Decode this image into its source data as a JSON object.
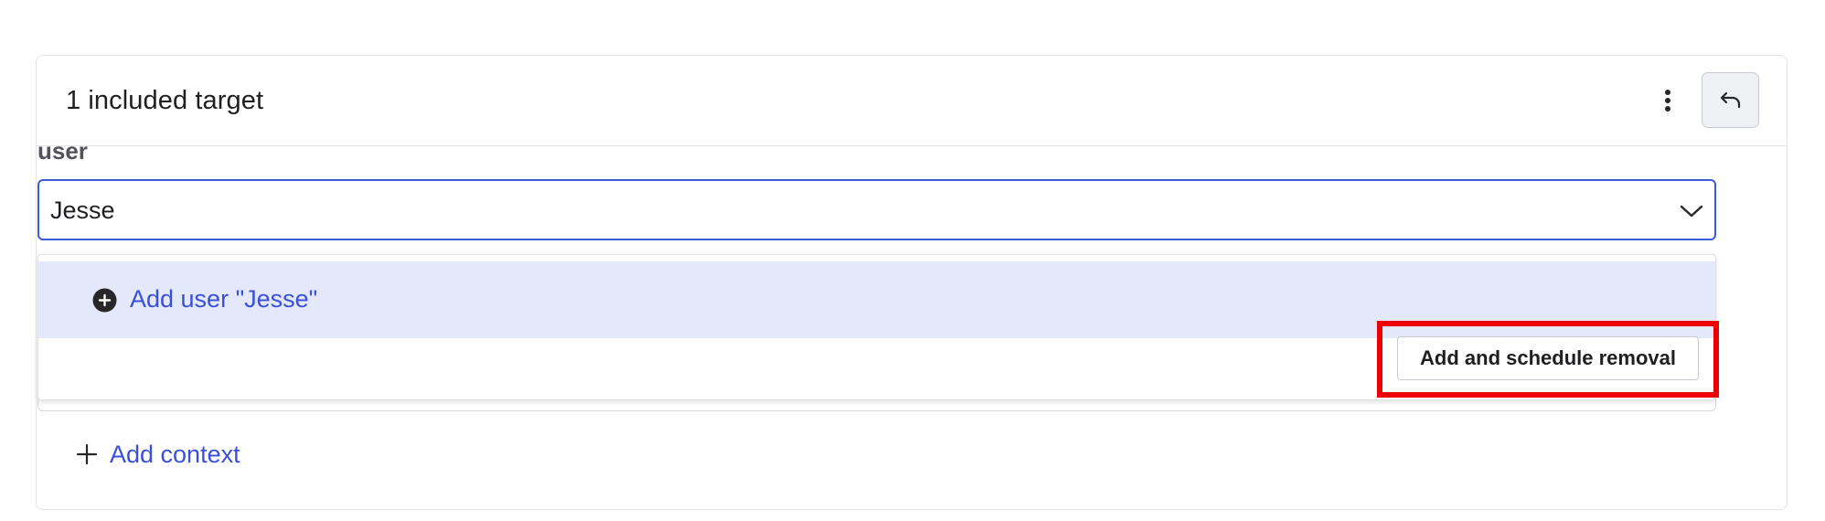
{
  "card": {
    "title": "1 included target",
    "menu_icon": "kebab-vertical-icon",
    "undo_icon": "undo-icon"
  },
  "field": {
    "label": "user",
    "value": "Jesse",
    "chevron_icon": "chevron-down-icon"
  },
  "dropdown": {
    "option_label": "Add user \"Jesse\"",
    "option_icon": "plus-circle-icon",
    "schedule_button_label": "Add and schedule removal"
  },
  "footer": {
    "add_context_label": "Add context",
    "plus_icon": "plus-icon"
  },
  "colors": {
    "accent": "#3b4fd8",
    "focus_border": "#3b5bdb",
    "option_highlight": "#e3e8fb",
    "annotation_red": "#ee0000"
  }
}
